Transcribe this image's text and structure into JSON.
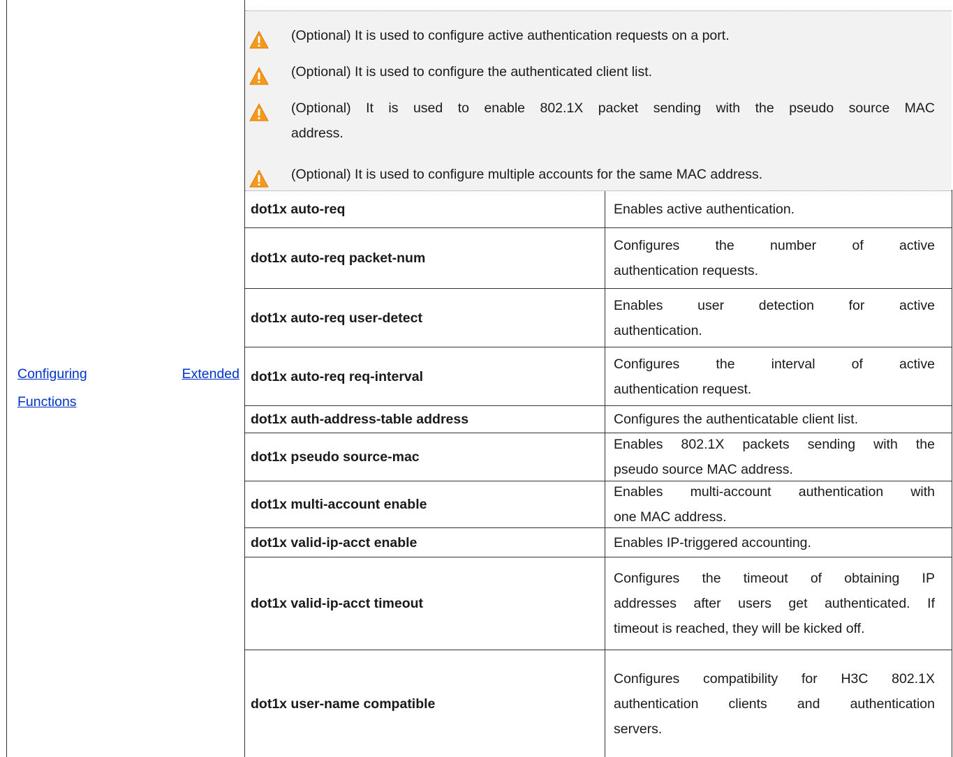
{
  "left": {
    "link_line1_a": "Configuring",
    "link_line1_b": "Extended",
    "link_line2": "Functions"
  },
  "notes": [
    {
      "text": "(Optional) It is used to configure active authentication requests on a port."
    },
    {
      "text": "(Optional) It is used to configure the authenticated client list."
    },
    {
      "text_line1": "(Optional) It is used to enable 802.1X packet sending with the pseudo source MAC",
      "text_line2": "address."
    },
    {
      "text": "(Optional) It is used to configure multiple accounts for the same MAC address."
    }
  ],
  "icons": {
    "note": "warning-triangle-icon",
    "color": "#f39a1c"
  },
  "rows": [
    {
      "command": "dot1x auto-req",
      "desc_lines": [
        "Enables active authentication."
      ]
    },
    {
      "command": "dot1x auto-req packet-num",
      "desc_lines": [
        "Configures the number of active",
        "authentication requests."
      ]
    },
    {
      "command": "dot1x auto-req user-detect",
      "desc_lines": [
        "Enables user detection for active",
        "authentication."
      ]
    },
    {
      "command": "dot1x auto-req req-interval",
      "desc_lines": [
        "Configures the interval of active",
        "authentication request."
      ]
    },
    {
      "command": "dot1x auth-address-table address",
      "desc_lines": [
        "Configures the authenticatable client list."
      ]
    },
    {
      "command": "dot1x pseudo source-mac",
      "desc_lines": [
        "Enables 802.1X packets sending with the",
        "pseudo source MAC address."
      ]
    },
    {
      "command": "dot1x multi-account enable",
      "desc_lines": [
        "Enables multi-account authentication with",
        "one MAC address."
      ]
    },
    {
      "command": "dot1x valid-ip-acct enable",
      "desc_lines": [
        "Enables IP-triggered accounting."
      ]
    },
    {
      "command": "dot1x valid-ip-acct timeout",
      "desc_lines": [
        "Configures the timeout of obtaining IP",
        "addresses after users get authenticated. If",
        "timeout is reached, they will be kicked off."
      ]
    },
    {
      "command": "dot1x user-name compatible",
      "desc_lines": [
        "Configures compatibility for H3C 802.1X",
        "authentication clients and authentication",
        "servers."
      ]
    }
  ]
}
